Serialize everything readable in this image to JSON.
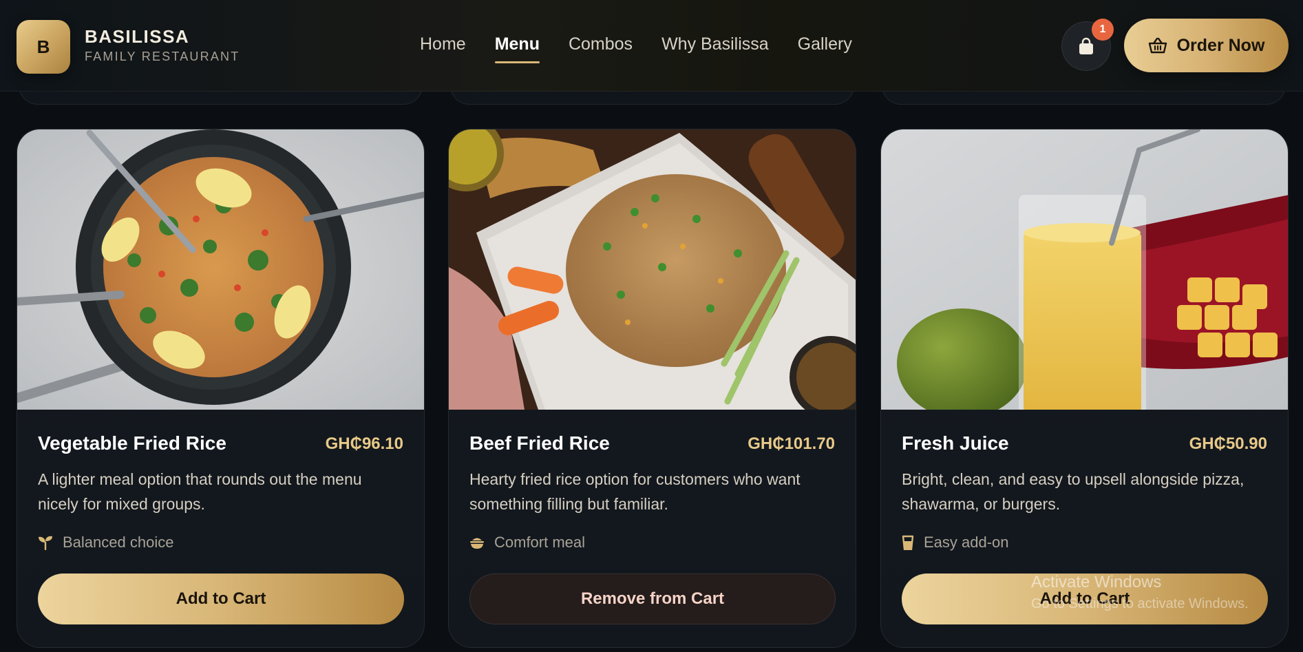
{
  "brand": {
    "logo_letter": "B",
    "name": "BASILISSA",
    "subtitle": "FAMILY RESTAURANT"
  },
  "nav": {
    "items": [
      {
        "label": "Home",
        "active": false
      },
      {
        "label": "Menu",
        "active": true
      },
      {
        "label": "Combos",
        "active": false
      },
      {
        "label": "Why Basilissa",
        "active": false
      },
      {
        "label": "Gallery",
        "active": false
      }
    ]
  },
  "cart": {
    "count": "1",
    "icon": "shopping-bag-icon"
  },
  "order_button": {
    "label": "Order Now",
    "icon": "basket-icon"
  },
  "cards": [
    {
      "title": "Vegetable Fried Rice",
      "price": "GH₵96.10",
      "description": "A lighter meal option that rounds out the menu nicely for mixed groups.",
      "tag": "Balanced choice",
      "tag_icon": "sprout-icon",
      "button": "Add to Cart"
    },
    {
      "title": "Beef Fried Rice",
      "price": "GH₵101.70",
      "description": "Hearty fried rice option for customers who want something filling but familiar.",
      "tag": "Comfort meal",
      "tag_icon": "bowl-icon",
      "button": "Remove from Cart"
    },
    {
      "title": "Fresh Juice",
      "price": "GH₵50.90",
      "description": "Bright, clean, and easy to upsell alongside pizza, shawarma, or burgers.",
      "tag": "Easy add-on",
      "tag_icon": "cup-icon",
      "button": "Add to Cart"
    }
  ],
  "watermark": {
    "line1": "Activate Windows",
    "line2": "Go to Settings to activate Windows."
  },
  "colors": {
    "accent_gold": "#d9b877",
    "price_gold": "#e8c988",
    "badge_orange": "#e8663f",
    "background": "#0b0f14"
  }
}
